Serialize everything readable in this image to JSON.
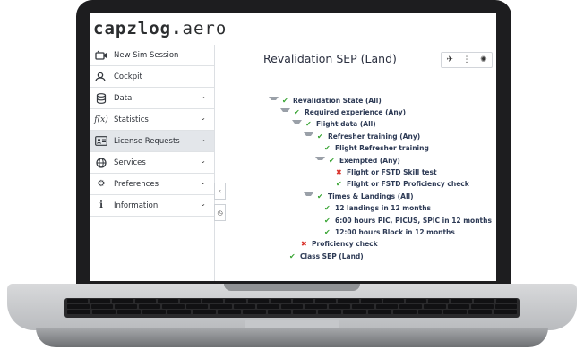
{
  "brand": {
    "name": "capzlog",
    "dot": ".",
    "tld": "aero"
  },
  "sidebar": {
    "items": [
      {
        "label": "New Sim Session",
        "icon": "sim-session-icon",
        "chevron": false,
        "active": false
      },
      {
        "label": "Cockpit",
        "icon": "user-icon",
        "chevron": false,
        "active": false
      },
      {
        "label": "Data",
        "icon": "database-icon",
        "chevron": true,
        "active": false
      },
      {
        "label": "Statistics",
        "icon": "function-icon",
        "chevron": true,
        "active": false
      },
      {
        "label": "License Requests",
        "icon": "license-icon",
        "chevron": true,
        "active": true
      },
      {
        "label": "Services",
        "icon": "globe-icon",
        "chevron": true,
        "active": false
      },
      {
        "label": "Preferences",
        "icon": "gears-icon",
        "chevron": true,
        "active": false
      },
      {
        "label": "Information",
        "icon": "info-icon",
        "chevron": true,
        "active": false
      }
    ]
  },
  "main": {
    "title": "Revalidation SEP (Land)",
    "toolbar": {
      "airplane": "✈",
      "more": "⋮",
      "seal": "✺"
    }
  },
  "tree": [
    {
      "label": "Revalidation State (All)",
      "depth": 0,
      "status": "ok",
      "expandable": true
    },
    {
      "label": "Required experience (Any)",
      "depth": 1,
      "status": "ok",
      "expandable": true
    },
    {
      "label": "Flight data (All)",
      "depth": 2,
      "status": "ok",
      "expandable": true
    },
    {
      "label": "Refresher training (Any)",
      "depth": 3,
      "status": "ok",
      "expandable": true
    },
    {
      "label": "Flight Refresher training",
      "depth": 4,
      "status": "ok",
      "expandable": false
    },
    {
      "label": "Exempted (Any)",
      "depth": 4,
      "status": "ok",
      "expandable": true
    },
    {
      "label": "Flight or FSTD Skill test",
      "depth": 5,
      "status": "fail",
      "expandable": false
    },
    {
      "label": "Flight or FSTD Proficiency check",
      "depth": 5,
      "status": "ok",
      "expandable": false
    },
    {
      "label": "Times & Landings (All)",
      "depth": 3,
      "status": "ok",
      "expandable": true
    },
    {
      "label": "12 landings in 12 months",
      "depth": 4,
      "status": "ok",
      "expandable": false
    },
    {
      "label": "6:00 hours PIC, PICUS, SPIC in 12 months",
      "depth": 4,
      "status": "ok",
      "expandable": false
    },
    {
      "label": "12:00 hours Block in 12 months",
      "depth": 4,
      "status": "ok",
      "expandable": false
    },
    {
      "label": "Proficiency check",
      "depth": 2,
      "status": "fail",
      "expandable": false
    },
    {
      "label": "Class SEP (Land)",
      "depth": 1,
      "status": "ok",
      "expandable": false
    }
  ],
  "icons": {
    "check": "✔",
    "cross": "✖"
  },
  "colors": {
    "check": "#3aa535",
    "cross": "#d9322b",
    "tree_text": "#2d3a55"
  }
}
